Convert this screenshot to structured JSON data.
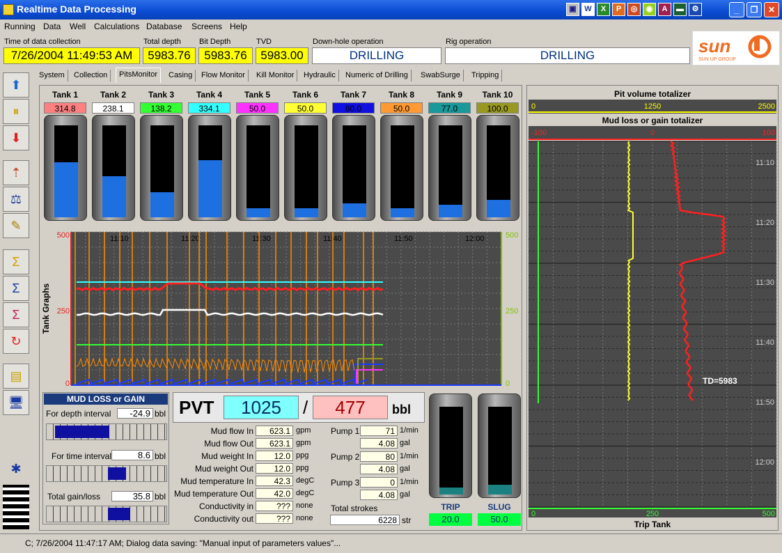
{
  "window": {
    "title": "Realtime Data Processing"
  },
  "menu": [
    "Running",
    "Data",
    "Well",
    "Calculations",
    "Database",
    "Screens",
    "Help"
  ],
  "info": {
    "time_label": "Time of data collection",
    "time": "7/26/2004 11:49:53 AM",
    "total_depth_label": "Total depth",
    "total_depth": "5983.76",
    "bit_depth_label": "Bit Depth",
    "bit_depth": "5983.76",
    "tvd_label": "TVD",
    "tvd": "5983.00",
    "downhole_label": "Down-hole operation",
    "downhole": "DRILLING",
    "rig_label": "Rig operation",
    "rig": "DRILLING"
  },
  "logo": {
    "text": "SUN",
    "sub": "SUN UP GROUP"
  },
  "tabs": [
    "System",
    "Collection",
    "PitsMonitor",
    "Casing",
    "Flow Monitor",
    "Kill Monitor",
    "Hydraulic",
    "Numeric of Drilling",
    "SwabSurge",
    "Tripping"
  ],
  "tanks": [
    {
      "name": "Tank 1",
      "value": "314.8",
      "color": "#ff8080",
      "level": 0.6
    },
    {
      "name": "Tank 2",
      "value": "238.1",
      "color": "#ffffff",
      "level": 0.45
    },
    {
      "name": "Tank 3",
      "value": "138.2",
      "color": "#33ff33",
      "level": 0.27
    },
    {
      "name": "Tank 4",
      "value": "334.1",
      "color": "#33ffff",
      "level": 0.62
    },
    {
      "name": "Tank 5",
      "value": "50.0",
      "color": "#ff33ff",
      "level": 0.1
    },
    {
      "name": "Tank 6",
      "value": "50.0",
      "color": "#ffff33",
      "level": 0.1
    },
    {
      "name": "Tank 7",
      "value": "80.0",
      "color": "#1010e0",
      "level": 0.15
    },
    {
      "name": "Tank 8",
      "value": "50.0",
      "color": "#ff9933",
      "level": 0.1
    },
    {
      "name": "Tank 9",
      "value": "77.0",
      "color": "#199999",
      "level": 0.14
    },
    {
      "name": "Tank 10",
      "value": "100.0",
      "color": "#999922",
      "level": 0.19
    }
  ],
  "tank_graph": {
    "ylabel": "Tank Graphs",
    "left_ticks": [
      "500",
      "250",
      "0"
    ],
    "right_ticks": [
      "500",
      "250",
      "0"
    ],
    "times": [
      "11:10",
      "11:20",
      "11:30",
      "11:40",
      "11:50",
      "12:00"
    ]
  },
  "mud": {
    "title": "MUD LOSS or GAIN",
    "depth_label": "For depth interval",
    "depth_value": "-24.9",
    "depth_unit": "bbl",
    "time_label": "For time interval",
    "time_value": "8.6",
    "time_unit": "bbl",
    "total_label": "Total gain/loss",
    "total_value": "35.8",
    "total_unit": "bbl"
  },
  "pvt": {
    "label": "PVT",
    "v1": "1025",
    "sep": "/",
    "v2": "477",
    "unit": "bbl"
  },
  "params": [
    {
      "label": "Mud flow In",
      "value": "623.1",
      "unit": "gpm"
    },
    {
      "label": "Mud flow Out",
      "value": "623.1",
      "unit": "gpm"
    },
    {
      "label": "Mud weight In",
      "value": "12.0",
      "unit": "ppg"
    },
    {
      "label": "Mud weight Out",
      "value": "12.0",
      "unit": "ppg"
    },
    {
      "label": "Mud temperature In",
      "value": "42.3",
      "unit": "degC"
    },
    {
      "label": "Mud temperature Out",
      "value": "42.0",
      "unit": "degC"
    },
    {
      "label": "Conductivity in",
      "value": "???",
      "unit": "none"
    },
    {
      "label": "Conductivity out",
      "value": "???",
      "unit": "none"
    }
  ],
  "pumps": [
    {
      "label": "Pump 1",
      "rate": "71",
      "rate_unit": "1/min",
      "vol": "4.08",
      "vol_unit": "gal"
    },
    {
      "label": "Pump 2",
      "rate": "80",
      "rate_unit": "1/min",
      "vol": "4.08",
      "vol_unit": "gal"
    },
    {
      "label": "Pump 3",
      "rate": "0",
      "rate_unit": "1/min",
      "vol": "4.08",
      "vol_unit": "gal"
    }
  ],
  "strokes": {
    "label": "Total strokes",
    "value": "6228",
    "unit": "str"
  },
  "trip": {
    "label": "TRIP",
    "value": "20.0"
  },
  "slug": {
    "label": "SLUG",
    "value": "50.0"
  },
  "right": {
    "pvt_title": "Pit volume totalizer",
    "pvt_ticks": [
      "0",
      "1250",
      "2500"
    ],
    "mud_title": "Mud loss or gain totalizer",
    "mud_ticks": [
      "-100",
      "0",
      "100"
    ],
    "times": [
      "11:10",
      "11:20",
      "11:30",
      "11:40",
      "11:50",
      "12:00"
    ],
    "td": "TD=5983",
    "trip_title": "Trip Tank",
    "trip_ticks": [
      "0",
      "250",
      "500"
    ]
  },
  "status": "C; 7/26/2004 11:47:17 AM;  Dialog data saving: \"Manual input of parameters values\"..."
}
